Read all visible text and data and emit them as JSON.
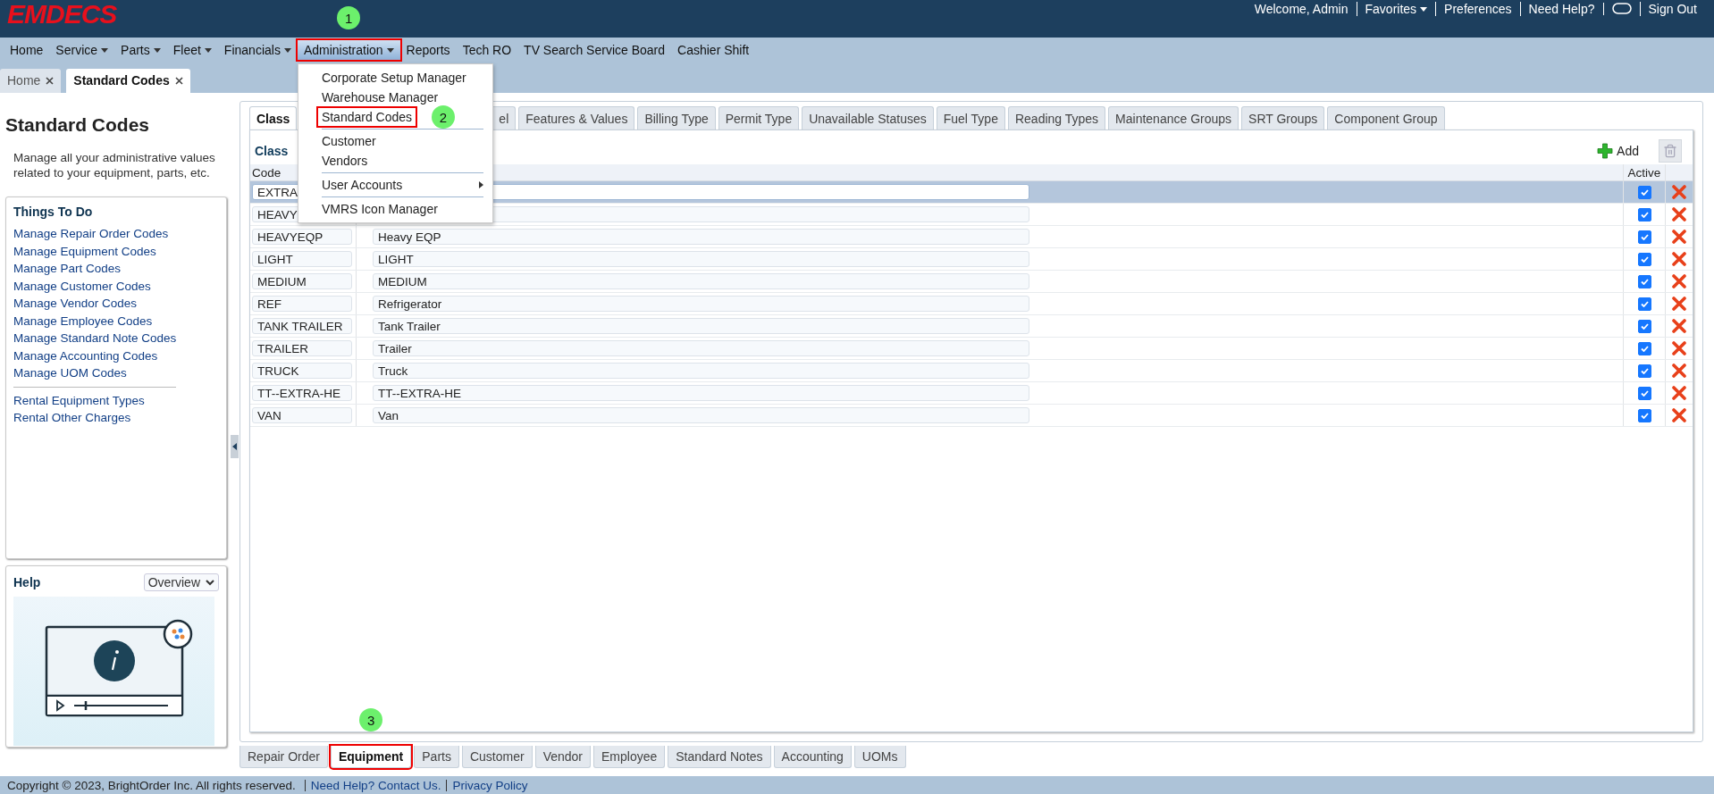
{
  "header": {
    "logo": "EMDECS",
    "links": [
      {
        "kind": "text",
        "label": "Welcome, Admin"
      },
      {
        "kind": "dropdown",
        "label": "Favorites"
      },
      {
        "kind": "link",
        "label": "Preferences"
      },
      {
        "kind": "link",
        "label": "Need Help?"
      },
      {
        "kind": "chat"
      },
      {
        "kind": "link",
        "label": "Sign Out"
      }
    ]
  },
  "nav": [
    {
      "label": "Home",
      "has_dropdown": false,
      "open": false,
      "highlighted": false
    },
    {
      "label": "Service",
      "has_dropdown": true,
      "open": false,
      "highlighted": false
    },
    {
      "label": "Parts",
      "has_dropdown": true,
      "open": false,
      "highlighted": false
    },
    {
      "label": "Fleet",
      "has_dropdown": true,
      "open": false,
      "highlighted": false
    },
    {
      "label": "Financials",
      "has_dropdown": true,
      "open": false,
      "highlighted": false
    },
    {
      "label": "Administration",
      "has_dropdown": true,
      "open": true,
      "highlighted": true,
      "step": "1",
      "menu": [
        [
          {
            "label": "Corporate Setup Manager",
            "has_submenu": false,
            "highlighted": false
          },
          {
            "label": "Warehouse Manager",
            "has_submenu": false,
            "highlighted": false
          },
          {
            "label": "Standard Codes",
            "has_submenu": false,
            "highlighted": true,
            "step": "2"
          }
        ],
        [
          {
            "label": "Customer",
            "has_submenu": false,
            "highlighted": false
          },
          {
            "label": "Vendors",
            "has_submenu": false,
            "highlighted": false
          }
        ],
        [
          {
            "label": "User Accounts",
            "has_submenu": true,
            "highlighted": false
          }
        ],
        [
          {
            "label": "VMRS Icon Manager",
            "has_submenu": false,
            "highlighted": false
          }
        ]
      ]
    },
    {
      "label": "Reports",
      "has_dropdown": false,
      "open": false,
      "highlighted": false
    },
    {
      "label": "Tech RO",
      "has_dropdown": false,
      "open": false,
      "highlighted": false
    },
    {
      "label": "TV Search Service Board",
      "has_dropdown": false,
      "open": false,
      "highlighted": false
    },
    {
      "label": "Cashier Shift",
      "has_dropdown": false,
      "open": false,
      "highlighted": false
    }
  ],
  "page_tabs": [
    {
      "label": "Home",
      "selected": false
    },
    {
      "label": "Standard Codes",
      "selected": true
    }
  ],
  "sidebar": {
    "title": "Standard Codes",
    "description": "Manage all your administrative values related to your equipment, parts, etc.",
    "todo": {
      "title": "Things To Do",
      "groups": [
        [
          "Manage Repair Order Codes",
          "Manage Equipment Codes",
          "Manage Part Codes",
          "Manage Customer Codes",
          "Manage Vendor Codes",
          "Manage Employee Codes",
          "Manage Standard Note Codes",
          "Manage Accounting Codes",
          "Manage UOM Codes"
        ],
        [
          "Rental Equipment Types",
          "Rental Other Charges"
        ]
      ]
    },
    "help": {
      "title": "Help",
      "dropdown": "Overview"
    }
  },
  "main": {
    "tabs": [
      {
        "label": "Class",
        "selected": true
      },
      {
        "label": "el",
        "selected": false
      },
      {
        "label": "Features & Values",
        "selected": false
      },
      {
        "label": "Billing Type",
        "selected": false
      },
      {
        "label": "Permit Type",
        "selected": false
      },
      {
        "label": "Unavailable Statuses",
        "selected": false
      },
      {
        "label": "Fuel Type",
        "selected": false
      },
      {
        "label": "Reading Types",
        "selected": false
      },
      {
        "label": "Maintenance Groups",
        "selected": false
      },
      {
        "label": "SRT Groups",
        "selected": false
      },
      {
        "label": "Component Group",
        "selected": false
      }
    ],
    "panel": {
      "title": "Class",
      "add_label": "Add",
      "trash_disabled": true,
      "columns": {
        "code": "Code",
        "active": "Active"
      },
      "rows": [
        {
          "code": "EXTRA",
          "selected": true,
          "active": true
        },
        {
          "code": "HEAVY",
          "selected": false,
          "active": true
        },
        {
          "code": "HEAVYEQP",
          "description": "Heavy EQP",
          "selected": false,
          "active": true
        },
        {
          "code": "LIGHT",
          "description": "LIGHT",
          "selected": false,
          "active": true
        },
        {
          "code": "MEDIUM",
          "description": "MEDIUM",
          "selected": false,
          "active": true
        },
        {
          "code": "REF",
          "description": "Refrigerator",
          "selected": false,
          "active": true
        },
        {
          "code": "TANK TRAILER",
          "description": "Tank Trailer",
          "selected": false,
          "active": true
        },
        {
          "code": "TRAILER",
          "description": "Trailer",
          "selected": false,
          "active": true
        },
        {
          "code": "TRUCK",
          "description": "Truck",
          "selected": false,
          "active": true
        },
        {
          "code": "TT--EXTRA-HE",
          "description": "TT--EXTRA-HE",
          "selected": false,
          "active": true
        },
        {
          "code": "VAN",
          "description": "Van",
          "selected": false,
          "active": true
        }
      ]
    },
    "bottom_tabs": [
      {
        "label": "Repair Order",
        "selected": false,
        "highlighted": false
      },
      {
        "label": "Equipment",
        "selected": true,
        "highlighted": true,
        "step": "3"
      },
      {
        "label": "Parts",
        "selected": false,
        "highlighted": false
      },
      {
        "label": "Customer",
        "selected": false,
        "highlighted": false
      },
      {
        "label": "Vendor",
        "selected": false,
        "highlighted": false
      },
      {
        "label": "Employee",
        "selected": false,
        "highlighted": false
      },
      {
        "label": "Standard Notes",
        "selected": false,
        "highlighted": false
      },
      {
        "label": "Accounting",
        "selected": false,
        "highlighted": false
      },
      {
        "label": "UOMs",
        "selected": false,
        "highlighted": false
      }
    ]
  },
  "footer": {
    "copyright": "Copyright © 2023, BrightOrder Inc. All rights reserved.",
    "links": [
      "Need Help? Contact Us.",
      "Privacy Policy"
    ]
  }
}
